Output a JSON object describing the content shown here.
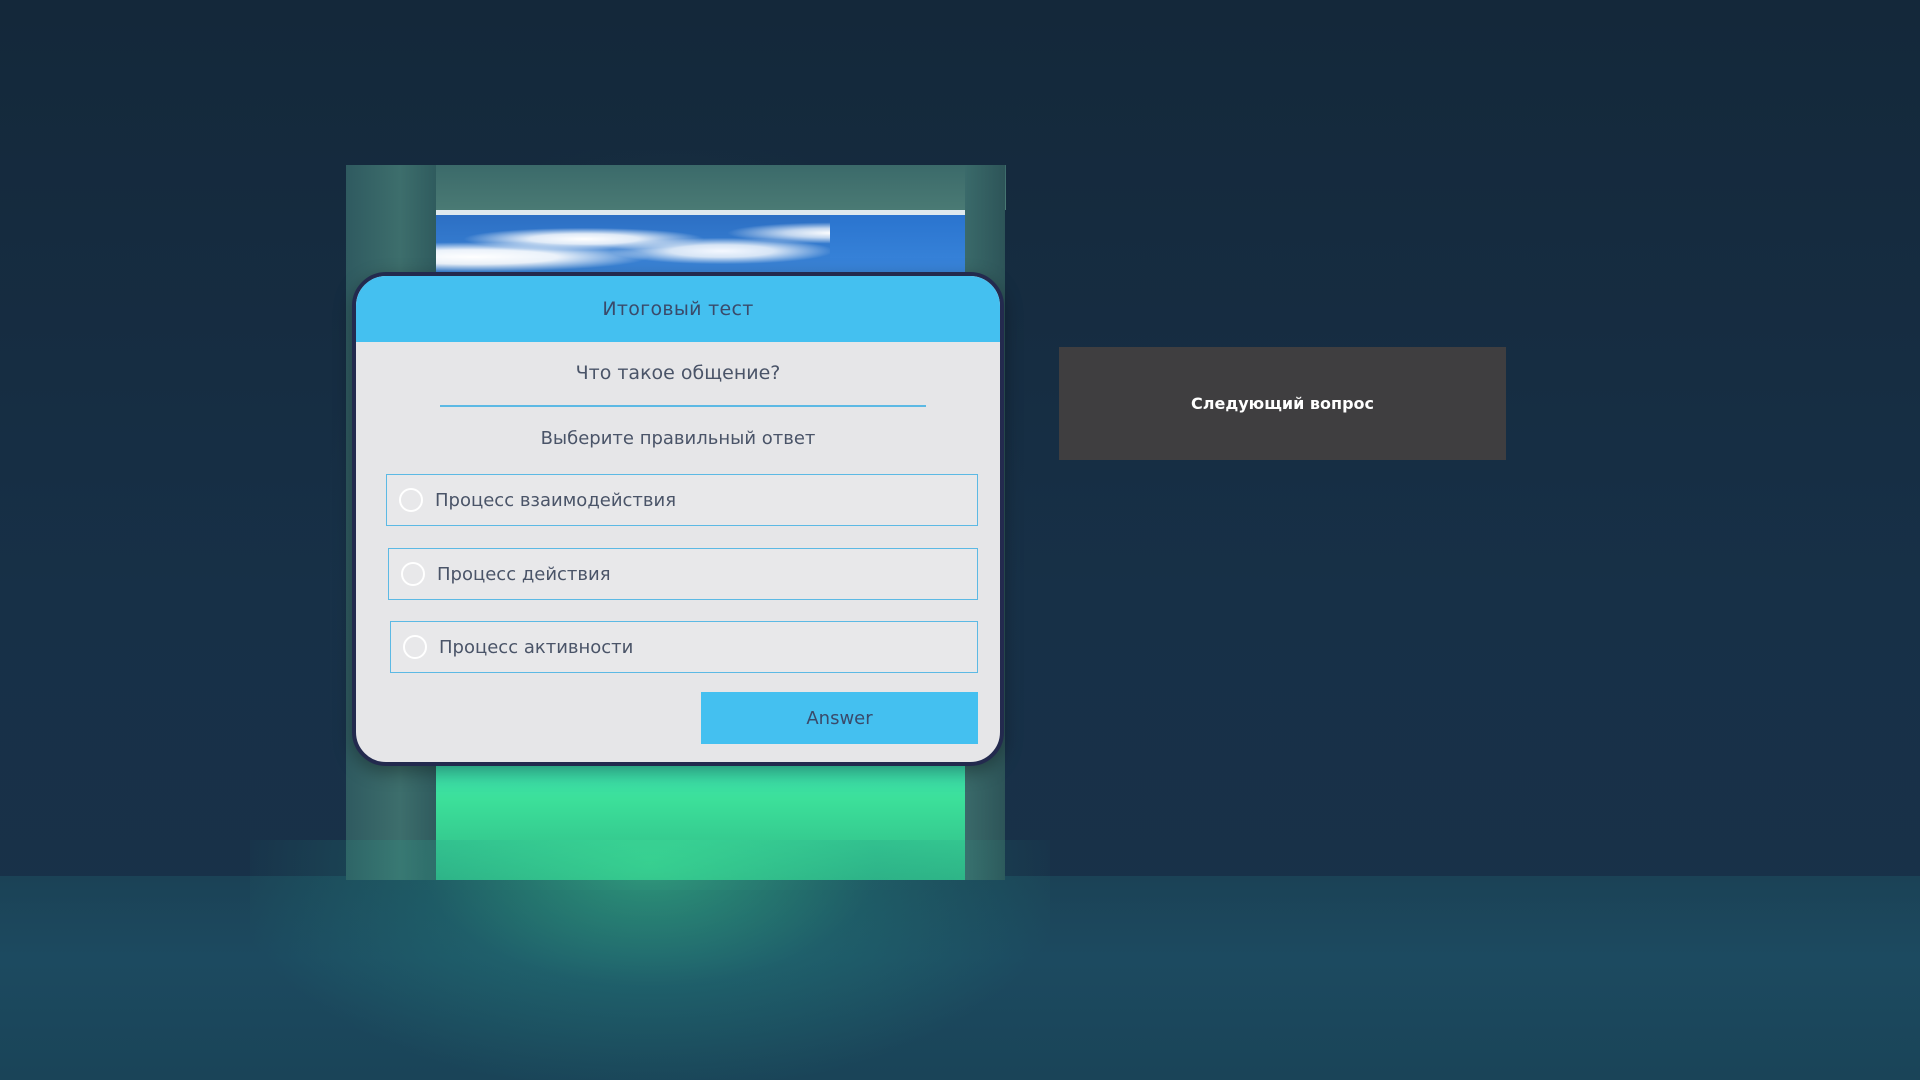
{
  "quiz": {
    "title": "Итоговый тест",
    "question": "Что такое общение?",
    "instruction": "Выберите правильный ответ",
    "options": [
      {
        "label": "Процесс взаимодействия",
        "selected": false
      },
      {
        "label": "Процесс действия",
        "selected": false
      },
      {
        "label": "Процесс активности",
        "selected": false
      }
    ],
    "answer_label": "Answer"
  },
  "next_question": {
    "label": "Следующий вопрос"
  },
  "colors": {
    "header": "#44c0f0",
    "panel": "#e6e6e8",
    "panel_border": "#232a4e",
    "next_panel": "#3f3e40",
    "background": "#173047"
  }
}
